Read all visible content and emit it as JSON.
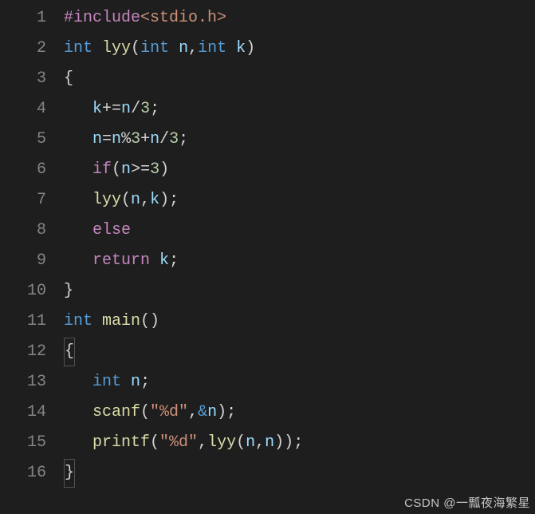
{
  "line_numbers": [
    "1",
    "2",
    "3",
    "4",
    "5",
    "6",
    "7",
    "8",
    "9",
    "10",
    "11",
    "12",
    "13",
    "14",
    "15",
    "16"
  ],
  "code": {
    "l1": {
      "include": "#include",
      "header": "<stdio.h>"
    },
    "l2": {
      "kw_int1": "int",
      "fn": "lyy",
      "p_open": "(",
      "kw_int2": "int",
      "sp1": " ",
      "n": "n",
      "comma": ",",
      "kw_int3": "int",
      "sp2": " ",
      "k": "k",
      "p_close": ")"
    },
    "l3": {
      "brace": "{"
    },
    "l4": {
      "k": "k",
      "op1": "+=",
      "n": "n",
      "op2": "/",
      "num": "3",
      "semi": ";"
    },
    "l5": {
      "n1": "n",
      "eq": "=",
      "n2": "n",
      "mod": "%",
      "num1": "3",
      "plus": "+",
      "n3": "n",
      "div": "/",
      "num2": "3",
      "semi": ";"
    },
    "l6": {
      "kw": "if",
      "p_open": "(",
      "n": "n",
      "op": ">=",
      "num": "3",
      "p_close": ")"
    },
    "l7": {
      "fn": "lyy",
      "p_open": "(",
      "n": "n",
      "comma": ",",
      "k": "k",
      "p_close": ")",
      "semi": ";"
    },
    "l8": {
      "kw": "else"
    },
    "l9": {
      "kw": "return",
      "sp": " ",
      "k": "k",
      "semi": ";"
    },
    "l10": {
      "brace": "}"
    },
    "l11": {
      "kw_int": "int",
      "fn": "main",
      "par": "()"
    },
    "l12": {
      "brace": "{"
    },
    "l13": {
      "kw_int": "int",
      "sp": " ",
      "n": "n",
      "semi": ";"
    },
    "l14": {
      "fn": "scanf",
      "p_open": "(",
      "str": "\"%d\"",
      "comma": ",",
      "amp": "&",
      "n": "n",
      "p_close": ")",
      "semi": ";"
    },
    "l15": {
      "fn": "printf",
      "p_open": "(",
      "str": "\"%d\"",
      "comma": ",",
      "fn2": "lyy",
      "p_open2": "(",
      "n1": "n",
      "comma2": ",",
      "n2": "n",
      "p_close2": ")",
      "p_close": ")",
      "semi": ";"
    },
    "l16": {
      "brace": "}"
    }
  },
  "watermark": "CSDN @一瓢夜海繁星"
}
